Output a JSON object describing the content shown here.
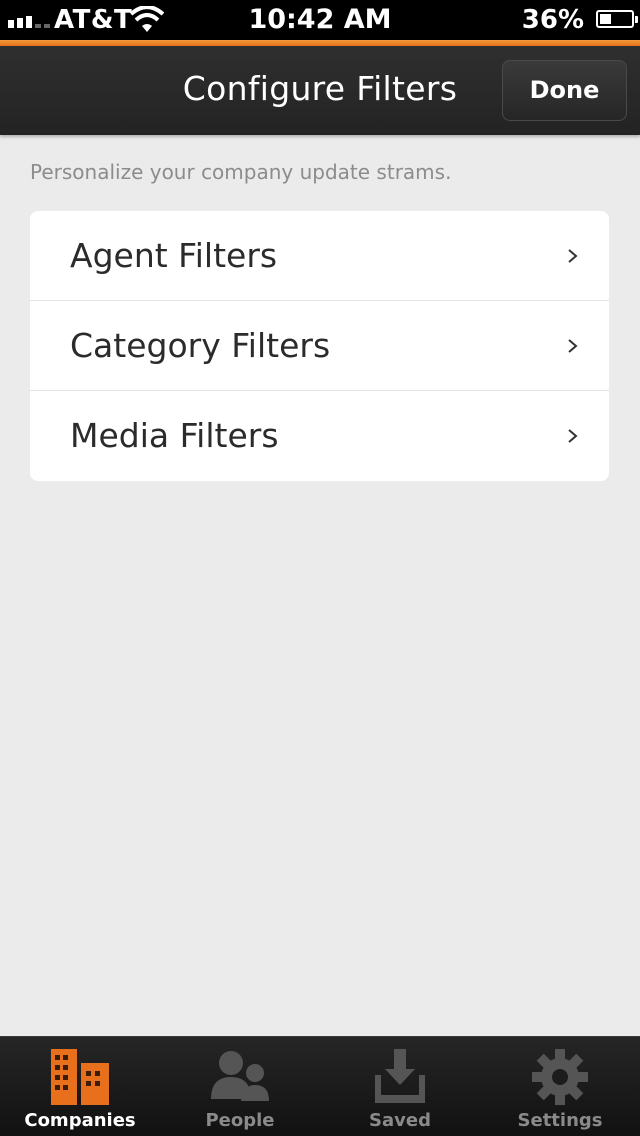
{
  "status_bar": {
    "carrier": "AT&T",
    "time": "10:42 AM",
    "battery_percent": "36%",
    "battery_level": 0.36
  },
  "header": {
    "title": "Configure Filters",
    "done_label": "Done"
  },
  "subtitle": "Personalize your company update strams.",
  "filters": [
    {
      "label": "Agent Filters",
      "chevron": ">"
    },
    {
      "label": "Category Filters",
      "chevron": ">"
    },
    {
      "label": "Media Filters",
      "chevron": ">"
    }
  ],
  "tabs": [
    {
      "label": "Companies",
      "icon": "buildings-icon",
      "active": true
    },
    {
      "label": "People",
      "icon": "people-icon",
      "active": false
    },
    {
      "label": "Saved",
      "icon": "download-tray-icon",
      "active": false
    },
    {
      "label": "Settings",
      "icon": "gear-icon",
      "active": false
    }
  ],
  "colors": {
    "accent": "#e8701c",
    "nav_background": "#2a2a2a",
    "page_background": "#ebebeb",
    "tab_inactive": "#8a8a8a"
  }
}
